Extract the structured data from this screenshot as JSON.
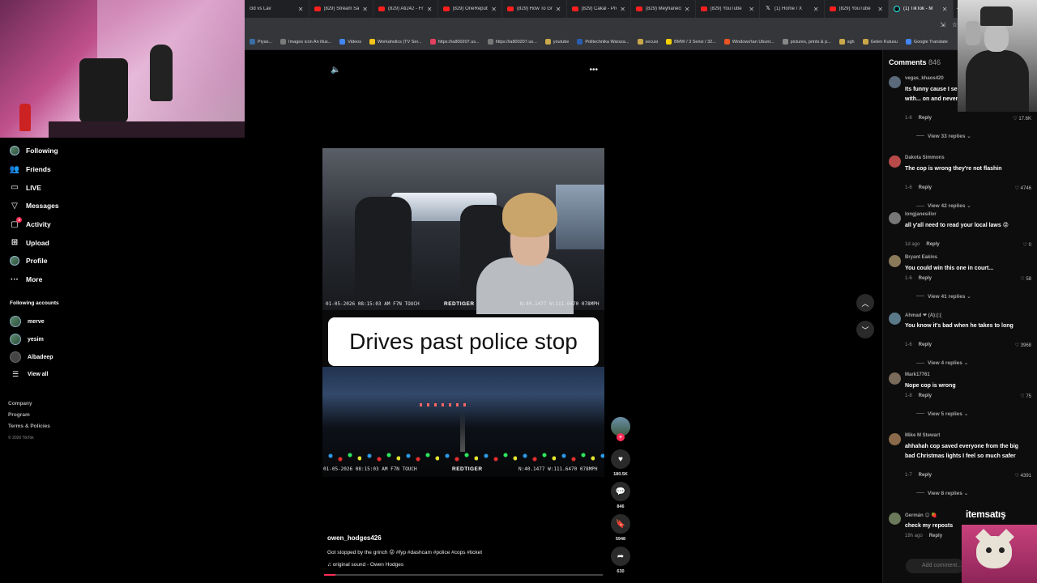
{
  "browser": {
    "tabs": [
      {
        "icon": "none",
        "title": "cld vs Lav"
      },
      {
        "icon": "youtube",
        "title": "(829) Stream Sav"
      },
      {
        "icon": "youtube",
        "title": "(829) Ati242 - Fr"
      },
      {
        "icon": "youtube",
        "title": "(829) OneRepubl"
      },
      {
        "icon": "youtube",
        "title": "(829) How To Gr"
      },
      {
        "icon": "youtube",
        "title": "(829) Cakal - Pro"
      },
      {
        "icon": "youtube",
        "title": "(829) Meyhaneci"
      },
      {
        "icon": "youtube",
        "title": "(829) YouTube"
      },
      {
        "icon": "x",
        "title": "(1) Home / X"
      },
      {
        "icon": "youtube",
        "title": "(829) YouTube"
      },
      {
        "icon": "tiktok",
        "title": "(1) TikTok - M"
      }
    ],
    "new_tab": "+",
    "bookmarks": [
      {
        "label": "Piyas...",
        "color": "#3a6ea5"
      },
      {
        "label": "Images icon An illus...",
        "color": "#7a7a7a"
      },
      {
        "label": "Videos",
        "color": "#4285f4"
      },
      {
        "label": "Workaholics (TV Ser...",
        "color": "#f5c518"
      },
      {
        "label": "https://ia800207.us...",
        "color": "#e4405f"
      },
      {
        "label": "https://ia800207.us...",
        "color": "#777"
      },
      {
        "label": "youtube",
        "color": "#caa84a"
      },
      {
        "label": "Politechnika Warsza...",
        "color": "#2a5db0"
      },
      {
        "label": "secusi",
        "color": "#caa84a"
      },
      {
        "label": "BMW / 3 Serisi / 32...",
        "color": "#f5d000"
      },
      {
        "label": "Windows'tan Ubunt...",
        "color": "#e95420"
      },
      {
        "label": "pictures, prints & p...",
        "color": "#888"
      },
      {
        "label": "sgh",
        "color": "#caa84a"
      },
      {
        "label": "Gelen Kutusu",
        "color": "#caa84a"
      },
      {
        "label": "Google Translate",
        "color": "#4285f4"
      }
    ]
  },
  "nav": {
    "items": [
      {
        "name": "following",
        "label": "Following",
        "icon": "avatar-icon"
      },
      {
        "name": "friends",
        "label": "Friends",
        "icon": "friends-icon"
      },
      {
        "name": "live",
        "label": "LIVE",
        "icon": "live-icon"
      },
      {
        "name": "messages",
        "label": "Messages",
        "icon": "send-icon"
      },
      {
        "name": "activity",
        "label": "Activity",
        "icon": "activity-icon",
        "badge": "3"
      },
      {
        "name": "upload",
        "label": "Upload",
        "icon": "plus-square-icon"
      },
      {
        "name": "profile",
        "label": "Profile",
        "icon": "avatar-icon"
      },
      {
        "name": "more",
        "label": "More",
        "icon": "ellipsis-icon"
      }
    ],
    "following_accounts_title": "Following accounts",
    "accounts": [
      "merve",
      "yesim",
      "Albadeep"
    ],
    "view_all": "View all",
    "footer": [
      "Company",
      "Program",
      "Terms & Policies"
    ],
    "copyright": "© 2026 TikTok"
  },
  "video": {
    "osd_top_left": "01-05-2026  08:15:03 AM  F7N TOUCH",
    "osd_top_brand": "REDTIGER",
    "osd_top_right": "N:40.1477  W:111.6470  078MPH",
    "caption": "Drives past police stop",
    "osd_bottom_left": "01-05-2026  08:15:03 AM  F7N TOUCH",
    "osd_bottom_brand": "REDTIGER",
    "osd_bottom_right": "N:40.1477  W:111.6470  078MPH",
    "progress": 0.04
  },
  "actions": {
    "likes": "180.5K",
    "comments": "846",
    "saves": "5948",
    "shares": "630"
  },
  "meta": {
    "author": "owen_hodges426",
    "description": "Got stopped by the grinch 😝 #fyp #dashcam #police #cops #ticket",
    "sound": "original sound - Owen Hodges"
  },
  "comments": {
    "title": "Comments",
    "count": "846",
    "items": [
      {
        "user": "vegas_khaos420",
        "text": "Its funny cause I se... driving around with... on and never getting pulled ove...",
        "time": "1-6",
        "likes": "17.6K",
        "replies": "View 33 replies",
        "avatar": "#5a6a7a"
      },
      {
        "user": "Dakota Simmons",
        "text": "The cop is wrong they're not flashin",
        "time": "1-6",
        "likes": "4746",
        "replies": "View 42 replies",
        "avatar": "#b84a4a"
      },
      {
        "user": "longjanesilivr",
        "text": "all y'all need to read your local laws 😡",
        "time": "1d ago",
        "likes": "0",
        "replies": "",
        "avatar": "#777"
      },
      {
        "user": "Bryant Eakins",
        "text": "You could win this one in court...",
        "time": "1-6",
        "likes": "58",
        "replies": "View 41 replies",
        "avatar": "#8a7a5a"
      },
      {
        "user": "Ahmad ❤ (A):(:(",
        "text": "You know it's bad when he takes to long",
        "time": "1-6",
        "likes": "3968",
        "replies": "View 4 replies",
        "avatar": "#5a7a8a"
      },
      {
        "user": "Mark17761",
        "text": "Nope cop is wrong",
        "time": "1-8",
        "likes": "75",
        "replies": "View 5 replies",
        "avatar": "#7a6a5a"
      },
      {
        "user": "Mike M Stewart",
        "text": "ahhahah cop saved everyone from the big bad Christmas lights I feel so much safer",
        "time": "1-7",
        "likes": "4391",
        "replies": "View 8 replies",
        "avatar": "#8a6a4a"
      },
      {
        "user": "Germán 😊 🍓",
        "text": "check my reposts",
        "time": "18h ago",
        "likes": "",
        "replies": "",
        "avatar": "#6a7a5a"
      }
    ],
    "reply_label": "Reply",
    "add_comment_placeholder": "Add comment..."
  },
  "overlays": {
    "sponsor": "itemsatış"
  }
}
